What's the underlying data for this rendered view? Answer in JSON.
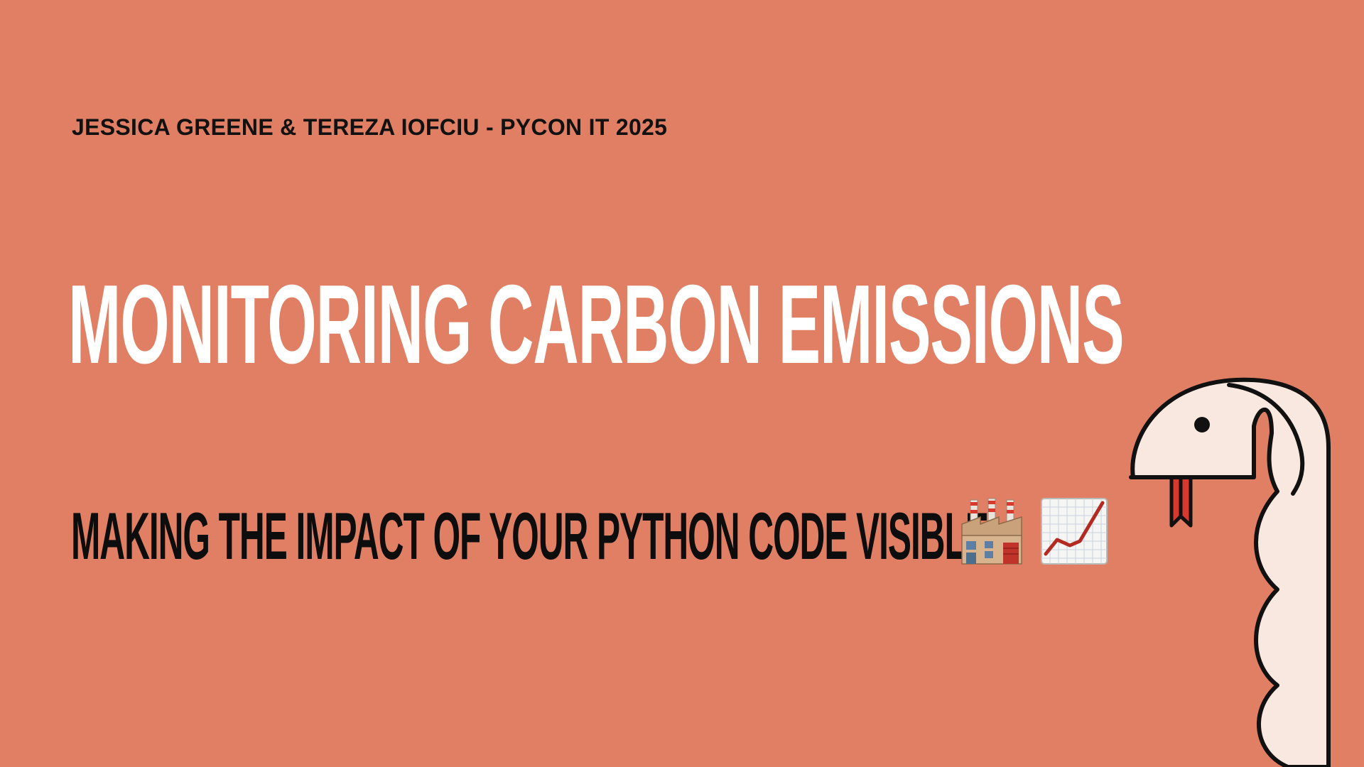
{
  "slide": {
    "byline": "JESSICA GREENE & TEREZA IOFCIU - PYCON IT 2025",
    "title": "MONITORING CARBON EMISSIONS",
    "subtitle": "MAKING THE IMPACT OF YOUR PYTHON CODE VISIBLE",
    "emojis": [
      "factory-icon",
      "chart-increasing-icon"
    ],
    "illustration": "snake-illustration",
    "colors": {
      "background": "#E07F63",
      "title": "#FFFFFF",
      "text": "#111111",
      "snake_body": "#F9E8DF",
      "snake_tongue": "#D8382E"
    }
  }
}
